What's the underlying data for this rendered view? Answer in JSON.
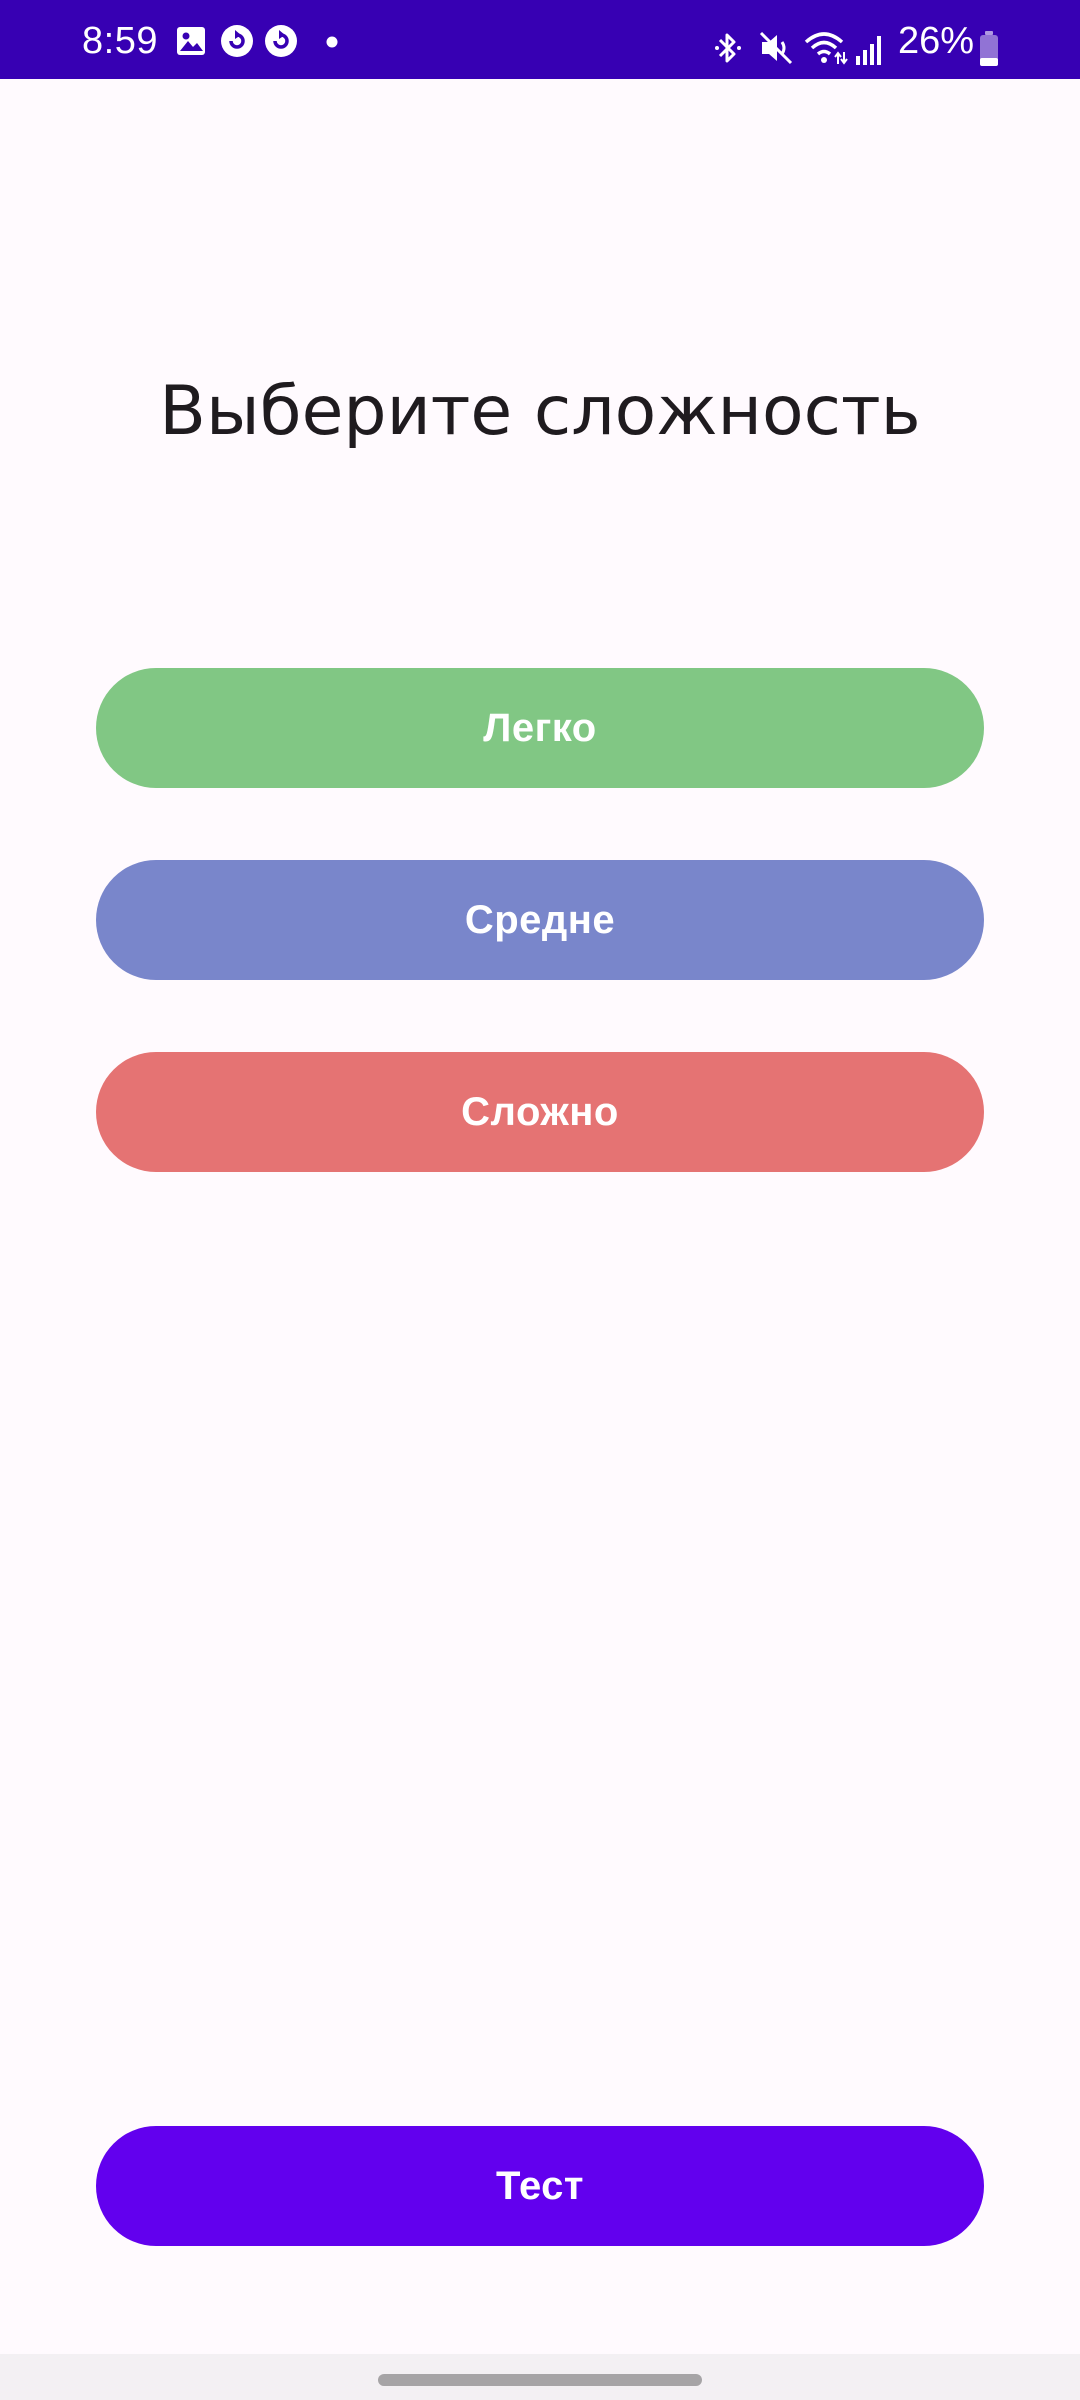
{
  "status_bar": {
    "time": "8:59",
    "battery_percent": "26%",
    "battery_level": 0.26,
    "left_icons": [
      "gallery-icon",
      "sync-icon",
      "sync-icon",
      "dot-icon"
    ],
    "right_icons": [
      "bluetooth-icon",
      "mute-icon",
      "wifi-icon",
      "signal-icon",
      "battery-icon"
    ],
    "background_color": "#3700B3"
  },
  "main": {
    "title": "Выберите сложность",
    "buttons": {
      "easy": {
        "label": "Легко",
        "color": "#81C784"
      },
      "medium": {
        "label": "Средне",
        "color": "#7986CB"
      },
      "hard": {
        "label": "Сложно",
        "color": "#E57373"
      }
    },
    "test_button": {
      "label": "Тест",
      "color": "#6200EE"
    }
  }
}
